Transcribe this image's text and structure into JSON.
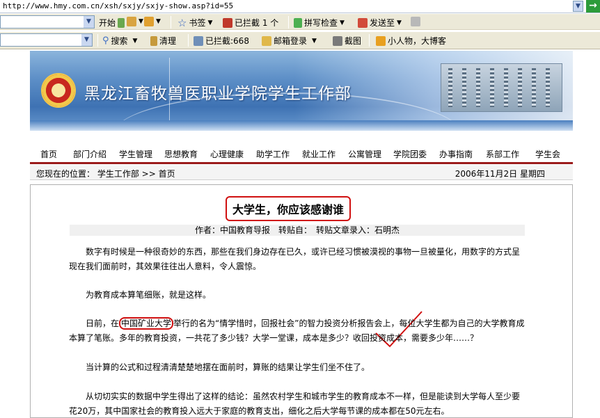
{
  "browser": {
    "url": "http://www.hmy.com.cn/xsh/sxjy/sxjy-show.asp?id=55",
    "toolbar1": {
      "start_label": "开始",
      "bookmarks_label": "书签",
      "blocked_label": "已拦截 1 个",
      "spell_label": "拼写检查",
      "send_label": "发送至"
    },
    "toolbar2": {
      "search_label": "搜索",
      "clean_label": "清理",
      "blocked_count_label": "已拦截:668",
      "mail_label": "邮箱登录",
      "screenshot_label": "截图",
      "blog_label": "小人物，大博客"
    }
  },
  "site": {
    "title": "黑龙江畜牧兽医职业学院学生工作部",
    "nav": [
      "首页",
      "部门介绍",
      "学生管理",
      "思想教育",
      "心理健康",
      "助学工作",
      "就业工作",
      "公寓管理",
      "学院团委",
      "办事指南",
      "系部工作",
      "学生会"
    ]
  },
  "breadcrumb": {
    "label": "您现在的位置：",
    "path": "学生工作部 >> 首页",
    "date": "2006年11月2日 星期四"
  },
  "article": {
    "title": "大学生，你应该感谢谁",
    "meta": "作者：中国教育导报　转贴自：　转贴文章录入：石明杰",
    "p1": "数字有时候是一种很奇妙的东西，那些在我们身边存在已久，或许已经习惯被漠视的事物一旦被量化，用数字的方式呈现在我们面前时，其效果往往出人意料，令人震惊。",
    "p2": "为教育成本算笔细账，就是这样。",
    "p3_before": "日前，在",
    "p3_highlight": "中国矿业大学",
    "p3_after": "举行的名为“情学惜时，回报社会”的智力投资分析报告会上，每位大学生都为自己的大学教育成本算了笔账。多年的教育投资，一共花了多少钱？大学一堂课，成本是多少？收回投资成本，需要多少年……？",
    "p4": "当计算的公式和过程清清楚楚地摆在面前时，算账的结果让学生们坐不住了。",
    "p5": "从切切实实的数据中学生得出了这样的结论：虽然农村学生和城市学生的教育成本不一样，但是能读到大学每人至少要花20万，其中国家社会的教育投入远大于家庭的教育支出，细化之后大学每节课的成本都在50元左右。"
  },
  "colors": {
    "accent_red": "#d01010",
    "nav_line": "#9b1c1c",
    "banner_blue": "#3e72b3"
  }
}
